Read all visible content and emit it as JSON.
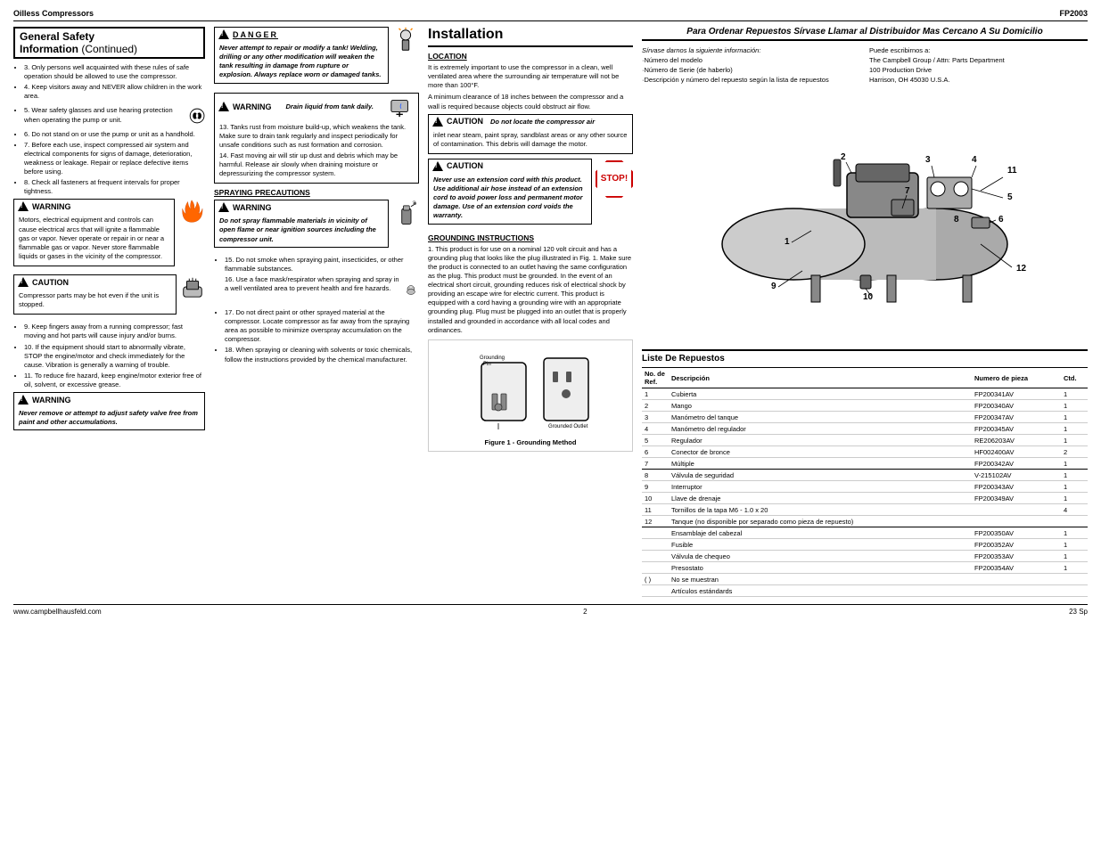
{
  "header": {
    "left": "Oilless Compressors",
    "right": "FP2003"
  },
  "left_col": {
    "section_title": "General Safety",
    "section_title2": "Information",
    "section_title_continued": "(Continued)",
    "items": [
      "3. Only persons well acquainted with these rules of safe operation should be allowed to use the compressor.",
      "4. Keep visitors away and NEVER allow children in the work area.",
      "5. Wear safety glasses and use hearing protection when operating the pump or unit.",
      "6. Do not stand on or use the pump or unit as a handhold.",
      "7. Before each use, inspect compressed air system and electrical components for signs of damage, deterioration, weakness or leakage. Repair or replace defective items before using.",
      "8. Check all fasteners at frequent intervals for proper tightness."
    ],
    "warning1_title": "WARNING",
    "warning1_text": "Motors, electrical equipment and controls can cause electrical arcs that will ignite a flammable gas or vapor. Never operate or repair in or near a flammable gas or vapor. Never store flammable liquids or gases in the vicinity of the compressor.",
    "caution1_title": "CAUTION",
    "caution1_text": "Compressor parts may be hot even if the unit is stopped.",
    "items2": [
      "9. Keep fingers away from a running compressor; fast moving and hot parts will cause injury and/or burns.",
      "10. If the equipment should start to abnormally vibrate, STOP the engine/motor and check immediately for the cause. Vibration is generally a warning of trouble.",
      "11. To reduce fire hazard, keep engine/motor exterior free of oil, solvent, or excessive grease."
    ],
    "warning2_title": "WARNING",
    "warning2_text": "Never remove or attempt to adjust safety valve free from paint and other accumulations."
  },
  "middle_col": {
    "danger_title": "DANGER",
    "danger_text": "Never attempt to repair or modify a tank! Welding, drilling or any other modification will weaken the tank resulting in damage from rupture or explosion. Always replace worn or damaged tanks.",
    "warning_drain_title": "WARNING",
    "warning_drain_label": "Drain liquid from tank daily.",
    "warning_drain_items": [
      "13. Tanks rust from moisture build-up, which weakens the tank. Make sure to drain tank regularly and inspect periodically for unsafe conditions such as rust formation and corrosion.",
      "14. Fast moving air will stir up dust and debris which may be harmful. Release air slowly when draining moisture or depressurizing the compressor system."
    ],
    "spraying_heading": "SPRAYING PRECAUTIONS",
    "warning_spray_title": "WARNING",
    "warning_spray_text": "Do not spray flammable materials in vicinity of open flame or near ignition sources including the compressor unit.",
    "spray_items": [
      "15. Do not smoke when spraying paint, insecticides, or other flammable substances.",
      "16. Use a face mask/respirator when spraying and spray in a well ventilated area to prevent health and fire hazards.",
      "17. Do not direct paint or other sprayed material at the compressor. Locate compressor as far away from the spraying area as possible to minimize overspray accumulation on the compressor.",
      "18. When spraying or cleaning with solvents or toxic chemicals, follow the instructions provided by the chemical manufacturer."
    ]
  },
  "right_col": {
    "installation_title": "Installation",
    "location_heading": "LOCATION",
    "location_text1": "It is extremely important to use the compressor in a clean, well ventilated area where the surrounding air temperature will not be more than 100°F.",
    "location_text2": "A minimum clearance of 18 inches between the compressor and a wall is required because objects could obstruct air flow.",
    "caution_locate_title": "CAUTION",
    "caution_locate_text": "Do not locate the compressor air inlet near steam, paint spray, sandblast areas or any other source of contamination. This debris will damage the motor.",
    "caution_extension_title": "CAUTION",
    "caution_extension_text": "Never use an extension cord with this product. Use additional air hose instead of an extension cord to avoid power loss and permanent motor damage. Use of an extension cord voids the warranty.",
    "grounding_heading": "GROUNDING INSTRUCTIONS",
    "grounding_items": [
      "1. This product is for use on a nominal 120 volt circuit and has a grounding plug that looks like the plug illustrated in Fig. 1. Make sure the product is connected to an outlet having the same configuration as the plug. This product must be grounded. In the event of an electrical short circuit, grounding reduces risk of electrical shock by providing an escape wire for electric current. This product is equipped with a cord having a grounding wire with an appropriate grounding plug. Plug must be plugged into an outlet that is properly installed and grounded in accordance with all local codes and ordinances."
    ],
    "figure_caption": "Figure 1 - Grounding Method",
    "grounding_pin_label": "Grounding Pin",
    "grounded_outlet_label": "Grounded Outlet"
  },
  "far_right": {
    "header": "Para Ordenar Repuestos Sírvase Llamar al Distribuidor Mas Cercano A Su Domicilio",
    "info_left_title": "Sírvase darnos la siguiente información:",
    "info_left_items": [
      "·Número  del modelo",
      "·Número de Serie (de haberlo)",
      "·Descripción y número del repuesto según la lista de repuestos"
    ],
    "info_right_title": "Puede escribirnos a:",
    "info_right_items": [
      "The Campbell Group / Attn: Parts Department",
      "100 Production Drive",
      "Harrison, OH  45030  U.S.A."
    ],
    "parts_list_title": "Liste De Repuestos",
    "table_headers": {
      "no": "No. de Ref.",
      "desc": "Descripción",
      "numero": "Numero de pieza",
      "ctd": "Ctd."
    },
    "parts": [
      {
        "no": "1",
        "desc": "Cubierta",
        "numero": "FP200341AV",
        "ctd": "1"
      },
      {
        "no": "2",
        "desc": "Mango",
        "numero": "FP200340AV",
        "ctd": "1"
      },
      {
        "no": "3",
        "desc": "Manómetro del tanque",
        "numero": "FP200347AV",
        "ctd": "1"
      },
      {
        "no": "4",
        "desc": "Manómetro del regulador",
        "numero": "FP200345AV",
        "ctd": "1"
      },
      {
        "no": "5",
        "desc": "Regulador",
        "numero": "RE206203AV",
        "ctd": "1"
      },
      {
        "no": "6",
        "desc": "Conector de bronce",
        "numero": "HF002400AV",
        "ctd": "2"
      },
      {
        "no": "7",
        "desc": "Múltiple",
        "numero": "FP200342AV",
        "ctd": "1"
      },
      {
        "no": "8",
        "desc": "Válvula de seguridad",
        "numero": "V-215102AV",
        "ctd": "1"
      },
      {
        "no": "9",
        "desc": "Interruptor",
        "numero": "FP200343AV",
        "ctd": "1"
      },
      {
        "no": "10",
        "desc": "Llave de drenaje",
        "numero": "FP200349AV",
        "ctd": "1"
      },
      {
        "no": "11",
        "desc": "Tornillos de la tapa M6 - 1.0 x 20",
        "numero": "",
        "ctd": "4"
      },
      {
        "no": "12",
        "desc": "Tanque (no disponible por separado como pieza de repuesto)",
        "numero": "",
        "ctd": ""
      },
      {
        "no": "",
        "desc": "Ensamblaje del cabezal",
        "numero": "FP200350AV",
        "ctd": "1"
      },
      {
        "no": "",
        "desc": "Fusible",
        "numero": "FP200352AV",
        "ctd": "1"
      },
      {
        "no": "",
        "desc": "Válvula de chequeo",
        "numero": "FP200353AV",
        "ctd": "1"
      },
      {
        "no": "",
        "desc": "Presostato",
        "numero": "FP200354AV",
        "ctd": "1"
      },
      {
        "no": "( )",
        "desc": "No se muestran",
        "numero": "",
        "ctd": ""
      },
      {
        "no": "",
        "desc": "Artículos estándards",
        "numero": "",
        "ctd": ""
      }
    ]
  },
  "footer": {
    "left": "www.campbellhausfeld.com",
    "center": "2",
    "right": "23 Sp"
  }
}
